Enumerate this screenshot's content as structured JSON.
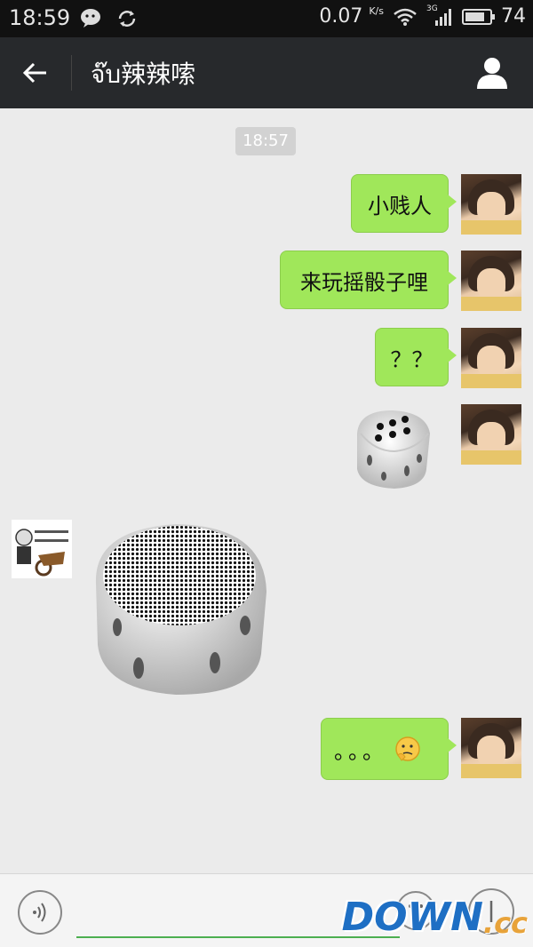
{
  "status_bar": {
    "time": "18:59",
    "net_speed": "0.07",
    "net_unit": "K/s",
    "signal_label": "3G",
    "battery": "74"
  },
  "header": {
    "title": "จ๊บ辣辣嗦"
  },
  "chat": {
    "timestamp": "18:57",
    "messages": [
      {
        "text": "小贱人"
      },
      {
        "text": "来玩摇骰子哩"
      },
      {
        "text": "？？"
      },
      {
        "text": "。。。"
      }
    ]
  },
  "input": {
    "placeholder": ""
  },
  "watermark": {
    "main": "DOWN",
    "suffix": ".cc"
  },
  "colors": {
    "accent": "#a0e75a",
    "header_bg": "#27292c",
    "background": "#ebebeb"
  }
}
